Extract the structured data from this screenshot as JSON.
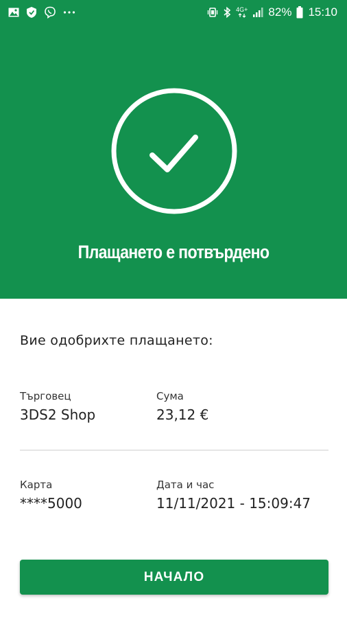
{
  "status_bar": {
    "battery_percent": "82%",
    "time": "15:10",
    "network": "4G+",
    "icons": [
      "image-icon",
      "shield-icon",
      "viber-icon",
      "more-dots-icon",
      "vibrate-icon",
      "bluetooth-icon",
      "network-4g-icon",
      "signal-icon",
      "battery-icon"
    ]
  },
  "hero": {
    "title": "Плащането е потвърдено",
    "icon": "check-circle-icon"
  },
  "main": {
    "approved_text": "Вие одобрихте плащането:",
    "merchant_label": "Търговец",
    "merchant_value": "3DS2 Shop",
    "amount_label": "Сума",
    "amount_value": "23,12 €",
    "card_label": "Карта",
    "card_value": "****5000",
    "datetime_label": "Дата и час",
    "datetime_value": "11/11/2021 - 15:09:47"
  },
  "actions": {
    "start_label": "НАЧАЛО"
  },
  "colors": {
    "brand_green": "#13914e",
    "text": "#222222",
    "divider": "#cfcfcf"
  }
}
